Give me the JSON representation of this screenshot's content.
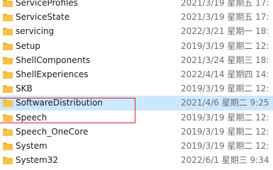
{
  "rows": [
    {
      "name": "ServiceProfiles",
      "date": "2021/3/19 星期五 17:"
    },
    {
      "name": "ServiceState",
      "date": "2021/3/19 星期五 17:"
    },
    {
      "name": "servicing",
      "date": "2022/3/21 星期一 18:"
    },
    {
      "name": "Setup",
      "date": "2019/3/19 星期二 12:"
    },
    {
      "name": "ShellComponents",
      "date": "2021/3/24 星期三 18:"
    },
    {
      "name": "ShellExperiences",
      "date": "2022/4/14 星期四 14:"
    },
    {
      "name": "SKB",
      "date": "2019/3/19 星期二 12:"
    },
    {
      "name": "SoftwareDistribution",
      "date": "2021/4/6 星期二 9:25"
    },
    {
      "name": "Speech",
      "date": "2019/3/19 星期二 12:"
    },
    {
      "name": "Speech_OneCore",
      "date": "2019/3/19 星期二 12:"
    },
    {
      "name": "System",
      "date": "2019/3/19 星期二 12:"
    },
    {
      "name": "System32",
      "date": "2022/6/1 星期三 9:34"
    }
  ],
  "selected_index": 7,
  "icon": "folder-icon",
  "colors": {
    "folder_body": "#f5c24c",
    "folder_tab": "#e6a92c",
    "selection": "#cce8ff",
    "highlight_box": "#e8202a"
  }
}
